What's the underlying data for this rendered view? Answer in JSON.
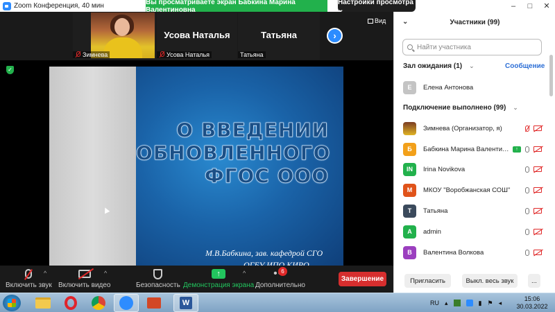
{
  "window": {
    "title": "Zoom Конференция, 40 мин",
    "sharing_banner": "Вы просматриваете экран Бабкина Марина Валентиновна",
    "view_options": "Настройки просмотра ⌄"
  },
  "video_strip": {
    "tiles": [
      {
        "nametag": "Зимнева",
        "has_photo": true
      },
      {
        "big_name": "Усова Наталья",
        "nametag": "Усова Наталья"
      },
      {
        "big_name": "Татьяна",
        "nametag": "Татьяна"
      }
    ],
    "view_label": "Вид"
  },
  "slide": {
    "title_lines": [
      "О ВВЕДЕНИИ",
      "ОБНОВЛЕННОГО",
      "ФГОС ООО"
    ],
    "author_line1": "М.В.Бабкина, зав. кафедрой СГО",
    "author_line2": "ОГБУ ИПО КИРО"
  },
  "toolbar": {
    "mute_label": "Включить звук",
    "video_label": "Включить видео",
    "security_label": "Безопасность",
    "share_label": "Демонстрация экрана",
    "more_label": "Дополнительно",
    "more_badge": "6",
    "end_label": "Завершение"
  },
  "panel": {
    "title": "Участники (99)",
    "search_placeholder": "Найти участника",
    "waiting_header": "Зал ожидания (1)",
    "message_link": "Сообщение",
    "waiting": [
      {
        "initial": "Е",
        "name": "Елена Антонова",
        "color": "#c4c4c4"
      }
    ],
    "connected_header": "Подключение выполнено (99)",
    "connected": [
      {
        "initial": "",
        "name": "Зимнева (Организатор, я)",
        "color": "",
        "photo": true
      },
      {
        "initial": "Б",
        "name": "Бабкина Марина Валентин...",
        "color": "#f2a01a",
        "sharing": true
      },
      {
        "initial": "IN",
        "name": "Irina Novikova",
        "color": "#22b14c"
      },
      {
        "initial": "М",
        "name": "МКОУ \"Воробжанская СОШ\"",
        "color": "#e0531a"
      },
      {
        "initial": "Т",
        "name": "Татьяна",
        "color": "#3b4a5c"
      },
      {
        "initial": "A",
        "name": "admin",
        "color": "#22b14c"
      },
      {
        "initial": "В",
        "name": "Валентина Волкова",
        "color": "#9b3fbf"
      }
    ],
    "invite_label": "Пригласить",
    "mute_all_label": "Выкл. весь звук",
    "more_label": "..."
  },
  "taskbar": {
    "lang": "RU",
    "time": "15:06",
    "date": "30.03.2022"
  }
}
